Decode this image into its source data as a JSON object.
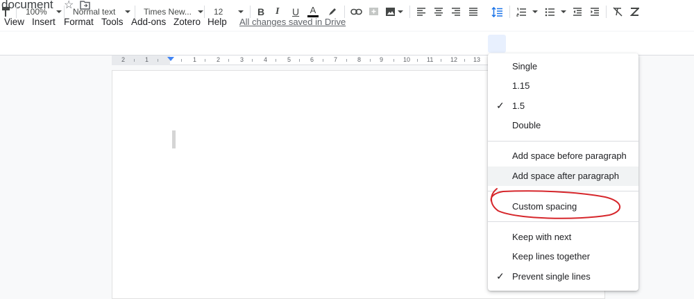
{
  "document": {
    "title": "document"
  },
  "menubar": {
    "items": [
      "View",
      "Insert",
      "Format",
      "Tools",
      "Add-ons",
      "Zotero",
      "Help"
    ],
    "saved_status": "All changes saved in Drive"
  },
  "toolbar": {
    "zoom": "100%",
    "style": "Normal text",
    "font": "Times New...",
    "font_size": "12",
    "text_color": "#000000"
  },
  "ruler": {
    "labels": [
      "2",
      "1",
      "1",
      "2",
      "3",
      "4",
      "5",
      "6",
      "7",
      "8",
      "9",
      "10",
      "11",
      "12",
      "13"
    ]
  },
  "spacing_menu": {
    "items": [
      {
        "label": "Single",
        "checked": false
      },
      {
        "label": "1.15",
        "checked": false
      },
      {
        "label": "1.5",
        "checked": true
      },
      {
        "label": "Double",
        "checked": false
      },
      {
        "label": "Add space before paragraph",
        "checked": false
      },
      {
        "label": "Add space after paragraph",
        "checked": false,
        "highlighted": true
      },
      {
        "label": "Custom spacing",
        "checked": false,
        "circled": true
      },
      {
        "label": "Keep with next",
        "checked": false
      },
      {
        "label": "Keep lines together",
        "checked": false
      },
      {
        "label": "Prevent single lines",
        "checked": true
      }
    ],
    "check_glyph": "✓"
  },
  "colors": {
    "accent": "#1a73e8",
    "annotation": "#d6262b"
  }
}
